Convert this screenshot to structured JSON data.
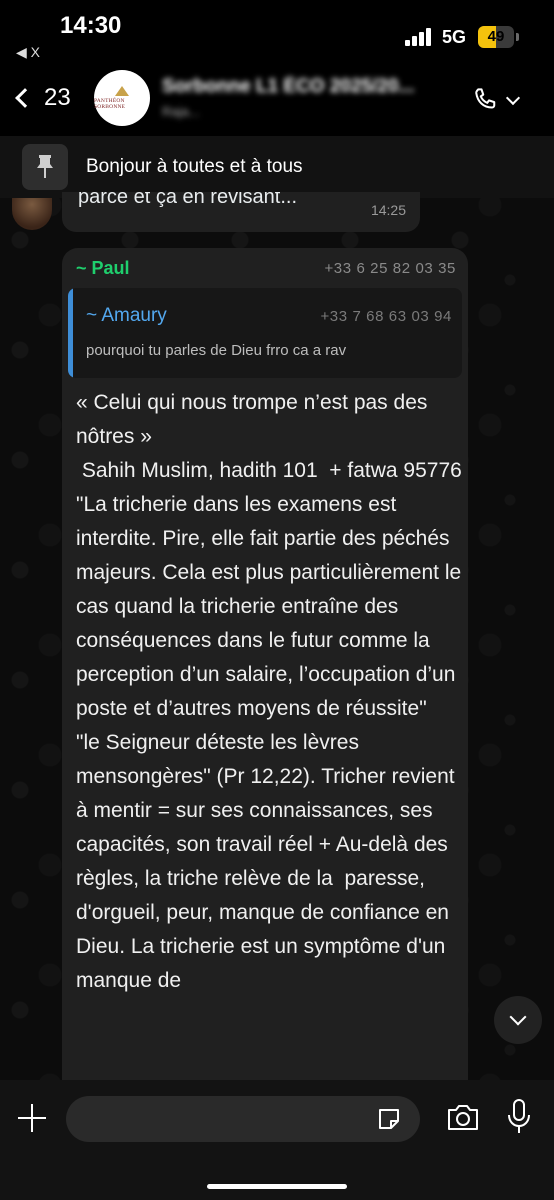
{
  "status_bar": {
    "time": "14:30",
    "back_app": "◀ X",
    "network": "5G",
    "battery": "49",
    "battery_level_percent": 49,
    "battery_color": "#f4c20d"
  },
  "header": {
    "back_count": "23",
    "avatar_text": "PANTHÉON SORBONNE",
    "group_title": "Sorbonne L1 ÉCO 2025/20...",
    "group_subtitle": "Raja..."
  },
  "pinned": {
    "text": "Bonjour à toutes et à tous",
    "icon": "pin-icon"
  },
  "previous_message": {
    "text": "parce et ça en révisant...",
    "time": "14:25"
  },
  "message": {
    "sender": "~ Paul",
    "sender_color": "#1fcf6d",
    "phone": "+33 6 25 82 03 35",
    "quote": {
      "name": "~ Amaury",
      "name_color": "#53a8ef",
      "phone": "+33 7 68 63 03 94",
      "text": "pourquoi tu parles de Dieu frro ca a rav"
    },
    "body": "« Celui qui nous trompe n’est pas des nôtres »\n Sahih Muslim, hadith 101  + fatwa 95776   \"La tricherie dans les examens est interdite. Pire, elle fait partie des péchés majeurs. Cela est plus particulièrement le cas quand la tricherie entraîne des conséquences dans le futur comme la perception d’un salaire, l’occupation d’un poste et d’autres moyens de réussite\"\n\"le Seigneur déteste les lèvres mensongères\" (Pr 12,22). Tricher revient à mentir = sur ses connaissances, ses capacités, son travail réel + Au-delà des règles, la triche relève de la  paresse, d'orgueil, peur, manque de confiance en Dieu. La tricherie est un symptôme d'un manque de"
  },
  "composer": {
    "placeholder": "",
    "icons": [
      "plus-icon",
      "sticker-icon",
      "camera-icon",
      "microphone-icon"
    ]
  }
}
